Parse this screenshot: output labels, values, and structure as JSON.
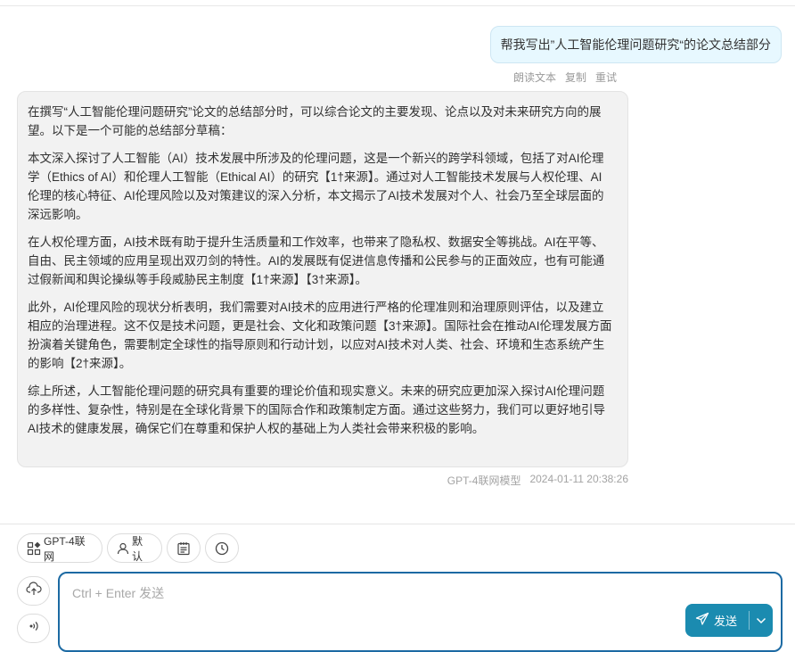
{
  "user_message": {
    "text": "帮我写出”人工智能伦理问题研究“的论文总结部分",
    "actions": [
      "朗读文本",
      "复制",
      "重试"
    ]
  },
  "assistant_message": {
    "paragraphs": [
      "在撰写“人工智能伦理问题研究”论文的总结部分时，可以综合论文的主要发现、论点以及对未来研究方向的展望。以下是一个可能的总结部分草稿：",
      "本文深入探讨了人工智能（AI）技术发展中所涉及的伦理问题，这是一个新兴的跨学科领域，包括了对AI伦理学（Ethics of AI）和伦理人工智能（Ethical AI）的研究【1†来源】。通过对人工智能技术发展与人权伦理、AI伦理的核心特征、AI伦理风险以及对策建议的深入分析，本文揭示了AI技术发展对个人、社会乃至全球层面的深远影响。",
      "在人权伦理方面，AI技术既有助于提升生活质量和工作效率，也带来了隐私权、数据安全等挑战。AI在平等、自由、民主领域的应用呈现出双刃剑的特性。AI的发展既有促进信息传播和公民参与的正面效应，也有可能通过假新闻和舆论操纵等手段威胁民主制度【1†来源】【3†来源】。",
      "此外，AI伦理风险的现状分析表明，我们需要对AI技术的应用进行严格的伦理准则和治理原则评估，以及建立相应的治理进程。这不仅是技术问题，更是社会、文化和政策问题【3†来源】。国际社会在推动AI伦理发展方面扮演着关键角色，需要制定全球性的指导原则和行动计划，以应对AI技术对人类、社会、环境和生态系统产生的影响【2†来源】。",
      "综上所述，人工智能伦理问题的研究具有重要的理论价值和现实意义。未来的研究应更加深入探讨AI伦理问题的多样性、复杂性，特别是在全球化背景下的国际合作和政策制定方面。通过这些努力，我们可以更好地引导AI技术的健康发展，确保它们在尊重和保护人权的基础上为人类社会带来积极的影响。"
    ],
    "model": "GPT-4联网模型",
    "timestamp": "2024-01-11 20:38:26"
  },
  "toolbar": {
    "model_chip": "GPT-4联网",
    "mask_chip": "默认"
  },
  "composer": {
    "placeholder": "Ctrl + Enter 发送",
    "send_label": "发送"
  },
  "colors": {
    "accent": "#1b8bb0",
    "input_border": "#1c6aa3",
    "user_bubble": "#e7f8ff"
  },
  "icons": [
    "grid-plus-icon",
    "user-icon",
    "clipboard-icon",
    "clock-icon",
    "cloud-upload-icon",
    "sound-wave-icon",
    "send-icon",
    "chevron-down-icon"
  ]
}
